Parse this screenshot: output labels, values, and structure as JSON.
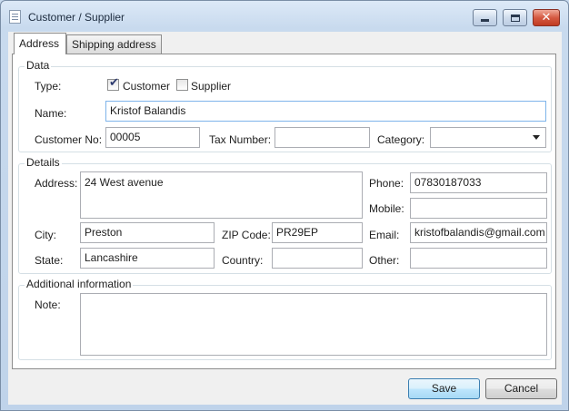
{
  "window": {
    "title": "Customer / Supplier"
  },
  "tabs": [
    {
      "label": "Address",
      "active": true
    },
    {
      "label": "Shipping address",
      "active": false
    }
  ],
  "data_group": {
    "legend": "Data",
    "type_label": "Type:",
    "customer_label": "Customer",
    "customer_checked": true,
    "supplier_label": "Supplier",
    "supplier_checked": false,
    "name_label": "Name:",
    "name_value": "Kristof Balandis",
    "customer_no_label": "Customer No:",
    "customer_no_value": "00005",
    "tax_number_label": "Tax Number:",
    "tax_number_value": "",
    "category_label": "Category:",
    "category_value": ""
  },
  "details_group": {
    "legend": "Details",
    "address_label": "Address:",
    "address_value": "24 West avenue",
    "phone_label": "Phone:",
    "phone_value": "07830187033",
    "mobile_label": "Mobile:",
    "mobile_value": "",
    "city_label": "City:",
    "city_value": "Preston",
    "zip_label": "ZIP Code:",
    "zip_value": "PR29EP",
    "email_label": "Email:",
    "email_value": "kristofbalandis@gmail.com",
    "state_label": "State:",
    "state_value": "Lancashire",
    "country_label": "Country:",
    "country_value": "",
    "other_label": "Other:",
    "other_value": ""
  },
  "additional_group": {
    "legend": "Additional information",
    "note_label": "Note:",
    "note_value": ""
  },
  "buttons": {
    "save": "Save",
    "cancel": "Cancel"
  },
  "icons": {
    "app": "document-icon",
    "minimize": "minimize-icon",
    "maximize": "maximize-icon",
    "close": "close-icon",
    "checkbox_tick": "check-icon",
    "dropdown": "chevron-down-icon"
  }
}
